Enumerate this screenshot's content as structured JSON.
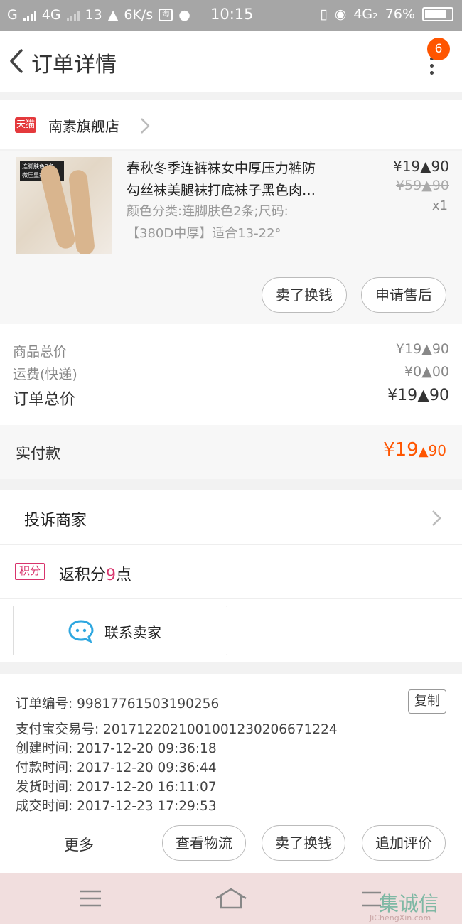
{
  "status_bar": {
    "carrier_left": "G",
    "network_1": "4G",
    "speed_prefix": "13",
    "speed_suffix": "6K/s",
    "app_icon_text": "淘",
    "time": "10:15",
    "network_2": "4G₂",
    "battery": "76%"
  },
  "navbar": {
    "title": "订单详情",
    "badge_count": "6"
  },
  "store": {
    "platform_tag": "天猫",
    "name": "南素旗舰店"
  },
  "product": {
    "thumb_tag_line1": "连脚肤色2条",
    "thumb_tag_line2": "微压显瘦美腿",
    "name_line1": "春秋冬季连裤袜女中厚压力裤防",
    "name_line2": "勾丝袜美腿袜打底袜子黑色肉…",
    "sku_line1": "颜色分类:连脚肤色2条;尺码:",
    "sku_line2": "【380D中厚】适合13-22°",
    "price_main": "¥19",
    "price_decimal": "90",
    "original_price_main": "¥59",
    "original_price_decimal": "90",
    "quantity": "x1",
    "btn_resell": "卖了换钱",
    "btn_aftersale": "申请售后"
  },
  "summary": {
    "goods_total_label": "商品总价",
    "goods_total_main": "¥19",
    "goods_total_decimal": "90",
    "shipping_label": "运费(快递)",
    "shipping_main": "¥0",
    "shipping_decimal": "00",
    "order_total_label": "订单总价",
    "order_total_main": "¥19",
    "order_total_decimal": "90"
  },
  "paid": {
    "label": "实付款",
    "main": "¥19",
    "decimal": "90"
  },
  "complain": {
    "label": "投诉商家"
  },
  "points": {
    "tag": "积分",
    "prefix": "返积分",
    "count": "9",
    "suffix": "点"
  },
  "contact": {
    "label": "联系卖家"
  },
  "order_info": {
    "order_no": "订单编号: 99817761503190256",
    "copy_label": "复制",
    "alipay_no": "支付宝交易号: 2017122021001001230206671224",
    "created": "创建时间: 2017-12-20  09:36:18",
    "paid": "付款时间: 2017-12-20  09:36:44",
    "shipped": "发货时间: 2017-12-20  16:11:07",
    "completed": "成交时间: 2017-12-23  17:29:53"
  },
  "action_bar": {
    "more": "更多",
    "logistics": "查看物流",
    "resell": "卖了换钱",
    "review": "追加评价"
  },
  "watermark": {
    "text": "集诚信",
    "sub": "JiChengXin.com"
  },
  "colors": {
    "accent": "#ff5500",
    "points": "#d8336c",
    "tmall": "#e4393c"
  }
}
